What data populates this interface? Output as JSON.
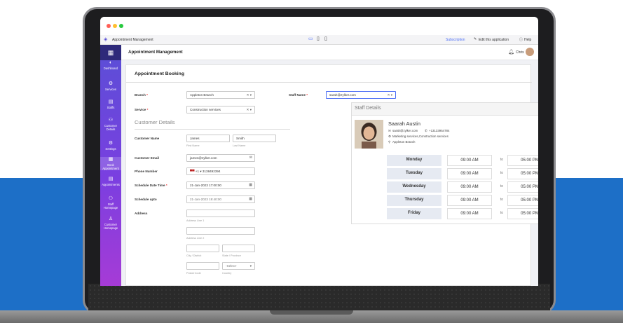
{
  "app": {
    "title": "Appointment Management",
    "header_links": {
      "subscription": "Subscription",
      "edit": "Edit this application",
      "help": "Help"
    },
    "user": "Chris"
  },
  "sidebar": {
    "items": [
      {
        "label": "Dashboard",
        "icon": "dashboard-icon",
        "glyph": "◐"
      },
      {
        "label": "Services",
        "icon": "gear-icon",
        "glyph": "⚙"
      },
      {
        "label": "Staffs",
        "icon": "briefcase-icon",
        "glyph": "▤"
      },
      {
        "label": "Customer Details",
        "icon": "users-icon",
        "glyph": "⚇"
      },
      {
        "label": "Settings",
        "icon": "settings-icon",
        "glyph": "⚙"
      },
      {
        "label": "Book Appointment",
        "icon": "calendar-icon",
        "glyph": "▦"
      },
      {
        "label": "Appointments",
        "icon": "list-icon",
        "glyph": "▤"
      },
      {
        "label": "Staff Homepage",
        "icon": "staff-icon",
        "glyph": "⚇"
      },
      {
        "label": "Customer Homepage",
        "icon": "user-icon",
        "glyph": "♙"
      }
    ]
  },
  "form": {
    "title": "Appointment Booking",
    "branch": {
      "label": "Branch",
      "value": "Appleton Branch"
    },
    "service": {
      "label": "Service",
      "value": "Construction services"
    },
    "staff_name": {
      "label": "Staff Name",
      "value": "sarah@zylker.com"
    },
    "customer_section": "Customer Details",
    "customer_name": {
      "label": "Customer Name",
      "first": "James",
      "last": "Smith",
      "first_hint": "First Name",
      "last_hint": "Last Name"
    },
    "customer_email": {
      "label": "Customer Email",
      "value": "james@zylker.com"
    },
    "phone": {
      "label": "Phone Number",
      "code": "+1",
      "value": "3138492394"
    },
    "schedule_time": {
      "label": "Schedule Date Time",
      "value": "21-Jan-2023 17:00:00"
    },
    "schedule_upto": {
      "label": "Schedule upto",
      "value": "21-Jan-2023 19:40:00"
    },
    "address": {
      "label": "Address",
      "line1": "Address Line 1",
      "line2": "Address Line 2",
      "city": "City / District",
      "state": "State / Province",
      "postal": "Postal Code",
      "country": "Country",
      "country_select": "-Select-"
    }
  },
  "staff_details": {
    "title": "Staff Details",
    "name": "Saarah Austin",
    "email": "sarah@zylker.com",
    "phone": "+13133954784",
    "services": "Marketing services,Construction services",
    "branch": "Appleton Branch",
    "to_label": "to",
    "schedule": [
      {
        "day": "Monday",
        "start": "09:00 AM",
        "end": "05:00 PM"
      },
      {
        "day": "Tuesday",
        "start": "09:00 AM",
        "end": "05:00 PM"
      },
      {
        "day": "Wednesday",
        "start": "09:00 AM",
        "end": "05:00 PM"
      },
      {
        "day": "Thursday",
        "start": "09:00 AM",
        "end": "05:00 PM"
      },
      {
        "day": "Friday",
        "start": "09:00 AM",
        "end": "05:00 PM"
      }
    ]
  },
  "colors": {
    "sidebar_top": "#5a4fd6",
    "sidebar_bottom": "#a63bd6",
    "background_band": "#1d6fc7",
    "accent": "#4c6ef5"
  }
}
